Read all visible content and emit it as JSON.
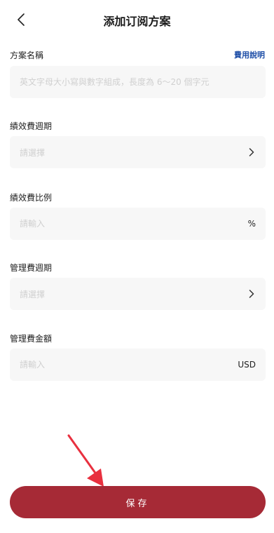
{
  "header": {
    "title": "添加订阅方案",
    "back_icon": "chevron-left-icon"
  },
  "form": {
    "plan_name": {
      "label": "方案名稱",
      "help_link": "費用說明",
      "placeholder": "英文字母大小寫與數字組成，長度為 6～20 個字元",
      "value": ""
    },
    "performance_fee_cycle": {
      "label": "績效費週期",
      "placeholder": "請選擇",
      "value": ""
    },
    "performance_fee_ratio": {
      "label": "績效費比例",
      "placeholder": "請輸入",
      "suffix": "%",
      "value": ""
    },
    "management_fee_cycle": {
      "label": "管理費週期",
      "placeholder": "請選擇",
      "value": ""
    },
    "management_fee_amount": {
      "label": "管理費金額",
      "placeholder": "請輸入",
      "suffix": "USD",
      "value": ""
    }
  },
  "save_button": {
    "label": "保存"
  },
  "colors": {
    "primary": "#a62a36",
    "link": "#1f4fa8",
    "field_bg": "#f7f7f7",
    "annotation": "#e8303f"
  }
}
